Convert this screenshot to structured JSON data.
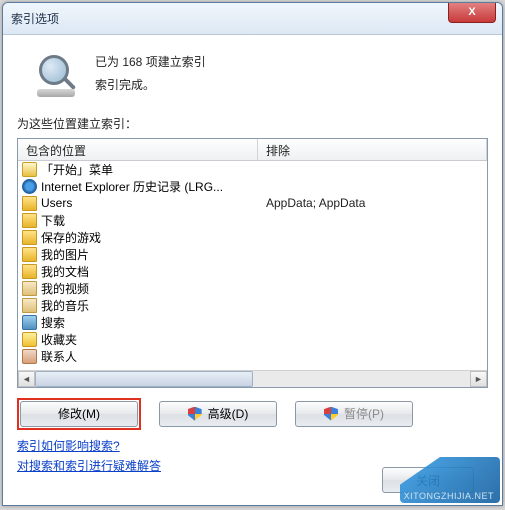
{
  "titlebar": {
    "title": "索引选项",
    "close": "X"
  },
  "status": {
    "line1": "已为 168 项建立索引",
    "line2": "索引完成。"
  },
  "section_label": "为这些位置建立索引：",
  "columns": {
    "c1": "包含的位置",
    "c2": "排除"
  },
  "rows": [
    {
      "icon": "ic-star",
      "label": "「开始」菜单",
      "exclude": ""
    },
    {
      "icon": "ic-ie",
      "label": "Internet Explorer 历史记录 (LRG...",
      "exclude": ""
    },
    {
      "icon": "ic-folder",
      "label": "Users",
      "exclude": "AppData; AppData"
    },
    {
      "icon": "ic-folder",
      "label": "下载",
      "exclude": ""
    },
    {
      "icon": "ic-folder",
      "label": "保存的游戏",
      "exclude": ""
    },
    {
      "icon": "ic-folder",
      "label": "我的图片",
      "exclude": ""
    },
    {
      "icon": "ic-folder",
      "label": "我的文档",
      "exclude": ""
    },
    {
      "icon": "ic-video",
      "label": "我的视频",
      "exclude": ""
    },
    {
      "icon": "ic-music",
      "label": "我的音乐",
      "exclude": ""
    },
    {
      "icon": "ic-search",
      "label": "搜索",
      "exclude": ""
    },
    {
      "icon": "ic-fav",
      "label": "收藏夹",
      "exclude": ""
    },
    {
      "icon": "ic-contact",
      "label": "联系人",
      "exclude": ""
    }
  ],
  "buttons": {
    "modify": "修改(M)",
    "advanced": "高级(D)",
    "pause": "暂停(P)"
  },
  "links": {
    "l1": "索引如何影响搜索?",
    "l2": "对搜索和索引进行疑难解答"
  },
  "bottom_button": "关闭",
  "watermark": "XITONGZHIJIA.NET"
}
